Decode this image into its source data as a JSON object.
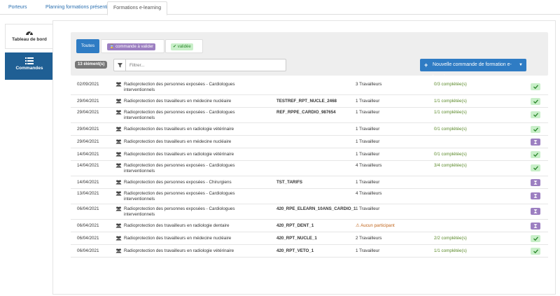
{
  "tabs": [
    {
      "label": "Porteurs"
    },
    {
      "label": "Planning formations présentielles"
    },
    {
      "label": "Formations e-learning"
    }
  ],
  "sidebar": {
    "items": [
      {
        "label": "Tableau de bord",
        "icon": "dashboard-icon"
      },
      {
        "label": "Commandes",
        "icon": "list-icon"
      }
    ]
  },
  "filters": {
    "all_label": "Toutes",
    "pending_label": "commande à valider",
    "validated_label": "validée"
  },
  "count_label": "13 élément(s)",
  "search": {
    "placeholder": "Filtrer..."
  },
  "new_order_label": "Nouvelle commande de formation e-learning",
  "colors": {
    "primary": "#2f7cc4",
    "sidebar_active": "#1f5f94",
    "pending": "#9c7fc1",
    "validated": "#c9efc9",
    "progress": "#5b8a2a",
    "warning": "#c0641a"
  },
  "orders": [
    {
      "date": "02/09/2021",
      "title": "Radioprotection des personnes exposées - Cardiologues interventionnels",
      "ref": "",
      "workers": "3 Travailleurs",
      "progress": "0/3 complétée(s)",
      "status": "validated"
    },
    {
      "date": "29/04/2021",
      "title": "Radioprotection des travailleurs en médecine nucléaire",
      "ref": "TESTREF_RPT_NUCLE_2468",
      "workers": "1 Travailleur",
      "progress": "1/1 complétée(s)",
      "status": "validated"
    },
    {
      "date": "29/04/2021",
      "title": "Radioprotection des personnes exposées - Cardiologues interventionnels",
      "ref": "REF_RPPE_CARDIO_987654",
      "workers": "1 Travailleur",
      "progress": "1/1 complétée(s)",
      "status": "validated"
    },
    {
      "date": "29/04/2021",
      "title": "Radioprotection des travailleurs en radiologie vétérinaire",
      "ref": "",
      "workers": "1 Travailleur",
      "progress": "0/1 complétée(s)",
      "status": "validated"
    },
    {
      "date": "29/04/2021",
      "title": "Radioprotection des travailleurs en médecine nucléaire",
      "ref": "",
      "workers": "1 Travailleur",
      "progress": "",
      "status": "pending"
    },
    {
      "date": "14/04/2021",
      "title": "Radioprotection des travailleurs en radiologie vétérinaire",
      "ref": "",
      "workers": "1 Travailleur",
      "progress": "0/1 complétée(s)",
      "status": "validated"
    },
    {
      "date": "14/04/2021",
      "title": "Radioprotection des personnes exposées - Cardiologues interventionnels",
      "ref": "",
      "workers": "4 Travailleurs",
      "progress": "3/4 complétée(s)",
      "status": "validated"
    },
    {
      "date": "14/04/2021",
      "title": "Radioprotection des personnes exposées - Chirurgiens",
      "ref": "TST_TARIFS",
      "workers": "1 Travailleur",
      "progress": "",
      "status": "pending"
    },
    {
      "date": "13/04/2021",
      "title": "Radioprotection des personnes exposées - Cardiologues interventionnels",
      "ref": "",
      "workers": "4 Travailleurs",
      "progress": "",
      "status": "pending"
    },
    {
      "date": "06/04/2021",
      "title": "Radioprotection des personnes exposées - Cardiologues interventionnels",
      "ref": "420_RPE_ELEARN_10ANS_CARDIO_1",
      "workers": "1 Travailleur",
      "progress": "",
      "status": "pending"
    },
    {
      "date": "06/04/2021",
      "title": "Radioprotection des travailleurs en radiologie dentaire",
      "ref": "420_RPT_DENT_1",
      "workers": "Aucun participant",
      "progress": "",
      "status": "pending"
    },
    {
      "date": "06/04/2021",
      "title": "Radioprotection des travailleurs en médecine nucléaire",
      "ref": "420_RPT_NUCLE_1",
      "workers": "2 Travailleurs",
      "progress": "2/2 complétée(s)",
      "status": "validated"
    },
    {
      "date": "06/04/2021",
      "title": "Radioprotection des travailleurs en radiologie vétérinaire",
      "ref": "420_RPT_VETO_1",
      "workers": "1 Travailleur",
      "progress": "1/1 complétée(s)",
      "status": "validated"
    }
  ]
}
